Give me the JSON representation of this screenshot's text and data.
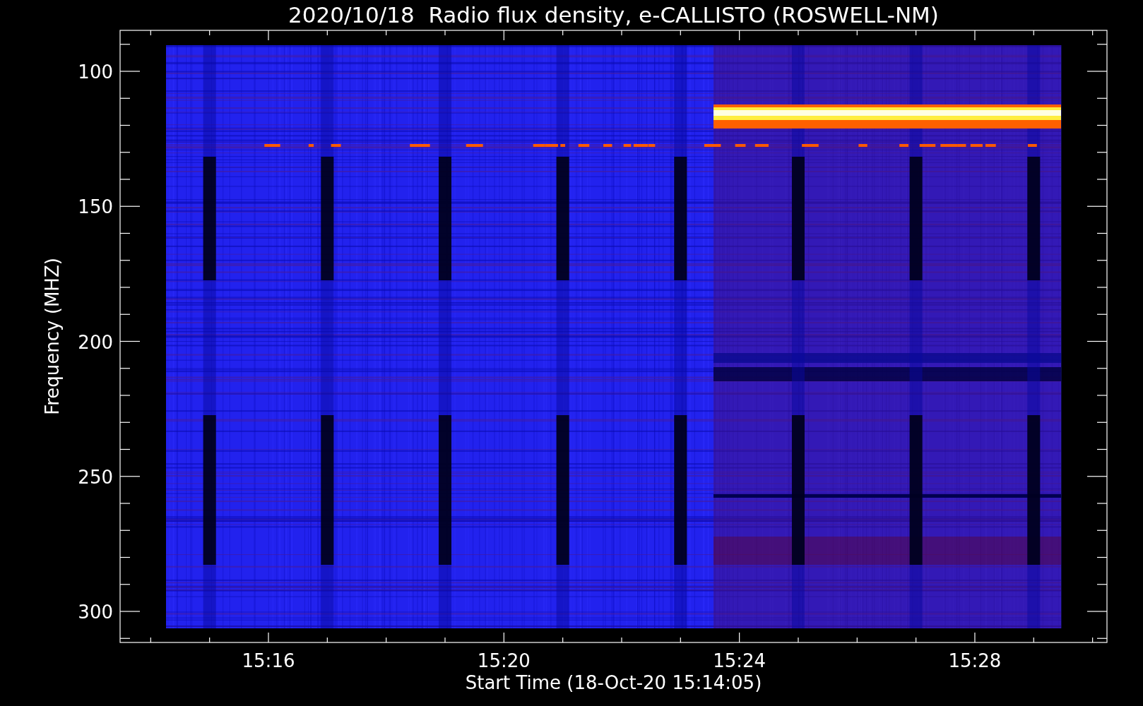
{
  "figure": {
    "title": "2020/10/18  Radio flux density, e-CALLISTO (ROSWELL-NM)",
    "xlabel": "Start Time (18-Oct-20 15:14:05)",
    "ylabel": "Frequency (MHZ)",
    "xticks": [
      "15:16",
      "15:20",
      "15:24",
      "15:28"
    ],
    "yticks": [
      "100",
      "150",
      "200",
      "250",
      "300"
    ]
  }
}
